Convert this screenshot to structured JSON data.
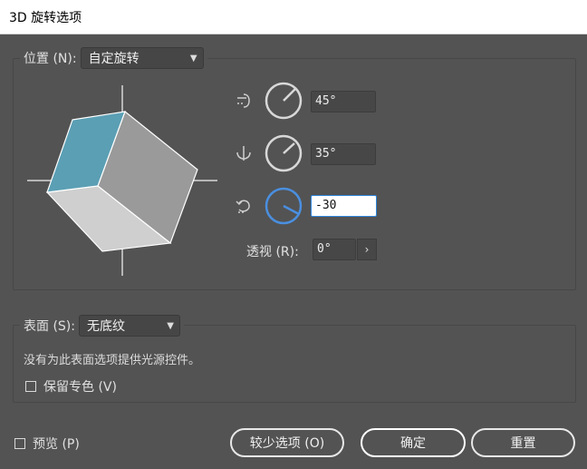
{
  "window": {
    "title": "3D 旋转选项"
  },
  "position": {
    "label": "位置 (N):",
    "preset": "自定旋转",
    "x_rotation": "45°",
    "y_rotation": "35°",
    "z_rotation": "-30",
    "perspective_label": "透视 (R):",
    "perspective": "0°"
  },
  "surface": {
    "label": "表面 (S):",
    "value": "无底纹",
    "note": "没有为此表面选项提供光源控件。",
    "preserve_spot_label": "保留专色 (V)"
  },
  "footer": {
    "preview_label": "预览 (P)",
    "fewer_options_label": "较少选项 (O)",
    "ok_label": "确定",
    "reset_label": "重置"
  },
  "colors": {
    "cube_top": "#5b9fb4",
    "cube_right": "#9a9a9a",
    "cube_left": "#cfcfcf",
    "active_dial": "#4a8fe0"
  },
  "icons": [
    "x-axis-rotate-icon",
    "y-axis-rotate-icon",
    "z-axis-rotate-icon",
    "chevron-down-icon",
    "chevron-right-icon"
  ]
}
